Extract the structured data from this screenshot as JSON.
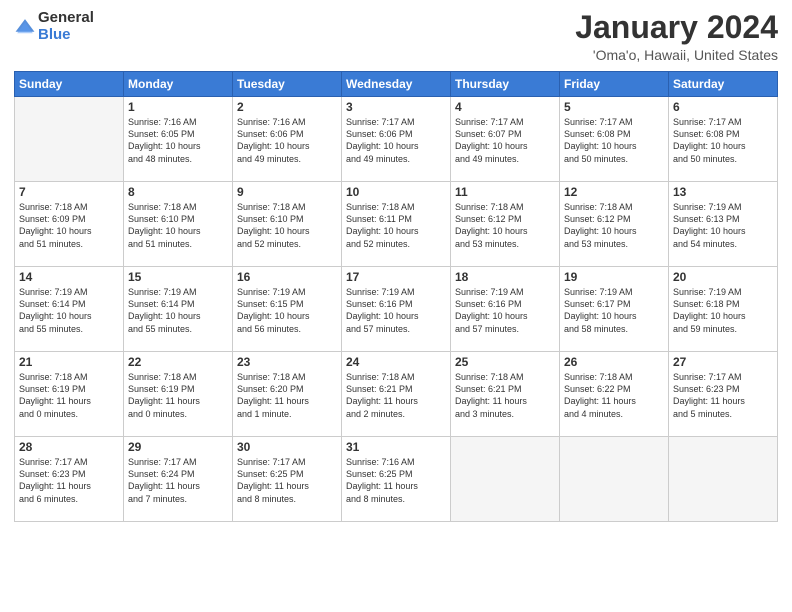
{
  "logo": {
    "general": "General",
    "blue": "Blue"
  },
  "header": {
    "title": "January 2024",
    "location": "'Oma'o, Hawaii, United States"
  },
  "weekdays": [
    "Sunday",
    "Monday",
    "Tuesday",
    "Wednesday",
    "Thursday",
    "Friday",
    "Saturday"
  ],
  "weeks": [
    [
      {
        "day": "",
        "info": ""
      },
      {
        "day": "1",
        "info": "Sunrise: 7:16 AM\nSunset: 6:05 PM\nDaylight: 10 hours\nand 48 minutes."
      },
      {
        "day": "2",
        "info": "Sunrise: 7:16 AM\nSunset: 6:06 PM\nDaylight: 10 hours\nand 49 minutes."
      },
      {
        "day": "3",
        "info": "Sunrise: 7:17 AM\nSunset: 6:06 PM\nDaylight: 10 hours\nand 49 minutes."
      },
      {
        "day": "4",
        "info": "Sunrise: 7:17 AM\nSunset: 6:07 PM\nDaylight: 10 hours\nand 49 minutes."
      },
      {
        "day": "5",
        "info": "Sunrise: 7:17 AM\nSunset: 6:08 PM\nDaylight: 10 hours\nand 50 minutes."
      },
      {
        "day": "6",
        "info": "Sunrise: 7:17 AM\nSunset: 6:08 PM\nDaylight: 10 hours\nand 50 minutes."
      }
    ],
    [
      {
        "day": "7",
        "info": "Sunrise: 7:18 AM\nSunset: 6:09 PM\nDaylight: 10 hours\nand 51 minutes."
      },
      {
        "day": "8",
        "info": "Sunrise: 7:18 AM\nSunset: 6:10 PM\nDaylight: 10 hours\nand 51 minutes."
      },
      {
        "day": "9",
        "info": "Sunrise: 7:18 AM\nSunset: 6:10 PM\nDaylight: 10 hours\nand 52 minutes."
      },
      {
        "day": "10",
        "info": "Sunrise: 7:18 AM\nSunset: 6:11 PM\nDaylight: 10 hours\nand 52 minutes."
      },
      {
        "day": "11",
        "info": "Sunrise: 7:18 AM\nSunset: 6:12 PM\nDaylight: 10 hours\nand 53 minutes."
      },
      {
        "day": "12",
        "info": "Sunrise: 7:18 AM\nSunset: 6:12 PM\nDaylight: 10 hours\nand 53 minutes."
      },
      {
        "day": "13",
        "info": "Sunrise: 7:19 AM\nSunset: 6:13 PM\nDaylight: 10 hours\nand 54 minutes."
      }
    ],
    [
      {
        "day": "14",
        "info": "Sunrise: 7:19 AM\nSunset: 6:14 PM\nDaylight: 10 hours\nand 55 minutes."
      },
      {
        "day": "15",
        "info": "Sunrise: 7:19 AM\nSunset: 6:14 PM\nDaylight: 10 hours\nand 55 minutes."
      },
      {
        "day": "16",
        "info": "Sunrise: 7:19 AM\nSunset: 6:15 PM\nDaylight: 10 hours\nand 56 minutes."
      },
      {
        "day": "17",
        "info": "Sunrise: 7:19 AM\nSunset: 6:16 PM\nDaylight: 10 hours\nand 57 minutes."
      },
      {
        "day": "18",
        "info": "Sunrise: 7:19 AM\nSunset: 6:16 PM\nDaylight: 10 hours\nand 57 minutes."
      },
      {
        "day": "19",
        "info": "Sunrise: 7:19 AM\nSunset: 6:17 PM\nDaylight: 10 hours\nand 58 minutes."
      },
      {
        "day": "20",
        "info": "Sunrise: 7:19 AM\nSunset: 6:18 PM\nDaylight: 10 hours\nand 59 minutes."
      }
    ],
    [
      {
        "day": "21",
        "info": "Sunrise: 7:18 AM\nSunset: 6:19 PM\nDaylight: 11 hours\nand 0 minutes."
      },
      {
        "day": "22",
        "info": "Sunrise: 7:18 AM\nSunset: 6:19 PM\nDaylight: 11 hours\nand 0 minutes."
      },
      {
        "day": "23",
        "info": "Sunrise: 7:18 AM\nSunset: 6:20 PM\nDaylight: 11 hours\nand 1 minute."
      },
      {
        "day": "24",
        "info": "Sunrise: 7:18 AM\nSunset: 6:21 PM\nDaylight: 11 hours\nand 2 minutes."
      },
      {
        "day": "25",
        "info": "Sunrise: 7:18 AM\nSunset: 6:21 PM\nDaylight: 11 hours\nand 3 minutes."
      },
      {
        "day": "26",
        "info": "Sunrise: 7:18 AM\nSunset: 6:22 PM\nDaylight: 11 hours\nand 4 minutes."
      },
      {
        "day": "27",
        "info": "Sunrise: 7:17 AM\nSunset: 6:23 PM\nDaylight: 11 hours\nand 5 minutes."
      }
    ],
    [
      {
        "day": "28",
        "info": "Sunrise: 7:17 AM\nSunset: 6:23 PM\nDaylight: 11 hours\nand 6 minutes."
      },
      {
        "day": "29",
        "info": "Sunrise: 7:17 AM\nSunset: 6:24 PM\nDaylight: 11 hours\nand 7 minutes."
      },
      {
        "day": "30",
        "info": "Sunrise: 7:17 AM\nSunset: 6:25 PM\nDaylight: 11 hours\nand 8 minutes."
      },
      {
        "day": "31",
        "info": "Sunrise: 7:16 AM\nSunset: 6:25 PM\nDaylight: 11 hours\nand 8 minutes."
      },
      {
        "day": "",
        "info": ""
      },
      {
        "day": "",
        "info": ""
      },
      {
        "day": "",
        "info": ""
      }
    ]
  ]
}
